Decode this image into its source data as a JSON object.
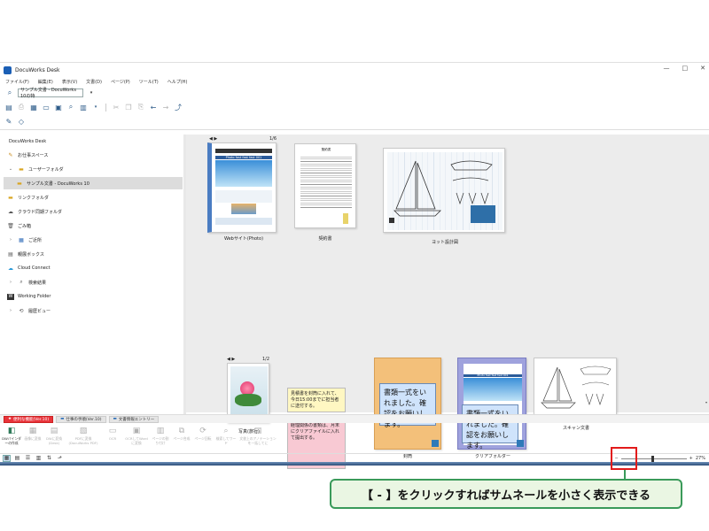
{
  "window": {
    "title": "DocuWorks Desk",
    "controls": [
      "—",
      "□",
      "✕"
    ]
  },
  "menu": [
    "ファイル(F)",
    "編集(E)",
    "表示(V)",
    "文書(D)",
    "ページ(P)",
    "ツール(T)",
    "ヘルプ(H)"
  ],
  "address": {
    "value": "サンプル文書 - DocuWorks 10の特"
  },
  "sidebar": {
    "root": "DocuWorks Desk",
    "items": [
      {
        "label": "お仕事スペース"
      },
      {
        "label": "ユーザーフォルダ"
      },
      {
        "label": "サンプル文書 - DocuWorks 10"
      },
      {
        "label": "リンクフォルダ"
      },
      {
        "label": "クラウド同期フォルダ"
      },
      {
        "label": "ごみ箱"
      },
      {
        "label": "ご近所"
      },
      {
        "label": "親展ボックス"
      },
      {
        "label": "Cloud Connect"
      },
      {
        "label": "検索結果"
      },
      {
        "label": "Working Folder"
      },
      {
        "label": "履歴ビュー"
      }
    ]
  },
  "documents": {
    "website": {
      "caption": "Webサイト(Photo)",
      "pager": "1/6",
      "banner": "Photo fast fast fast 001"
    },
    "contract": {
      "caption": "契約書",
      "title": "契約書"
    },
    "yacht": {
      "caption": "ヨット設計図"
    },
    "photo": {
      "caption": "写真(旅行)",
      "pager": "1/2"
    },
    "envelope": {
      "caption": "封筒",
      "text": "書類一式をいれました。確認をお願いします。"
    },
    "clearfolder": {
      "caption": "クリアフォルダー",
      "text": "書類一式をいれました。確認をお願いします。",
      "banner": "Photo fast fast fast 001"
    },
    "scan": {
      "caption": "スキャン文書"
    }
  },
  "stickies": {
    "yellow": "見積書を封筒に入れて、今日15:00までに担当者に送付する。",
    "pink": "経理関係の書類は、月末にクリアファイルに入れて提出する。"
  },
  "tabs": [
    {
      "label": "便利な機能(Ver.10)"
    },
    {
      "label": "仕事の手順(Ver.10)"
    },
    {
      "label": "文書情報エントリー"
    }
  ],
  "actions": [
    {
      "label": "DWバインダーの作成"
    },
    {
      "label": "画像に変換"
    },
    {
      "label": "DWに変換(Desk)"
    },
    {
      "label": "PDFに変換(DocuWorks PDF)"
    },
    {
      "label": "OCR"
    },
    {
      "label": "OCRしてWordに変換"
    },
    {
      "label": "ページの割り付け"
    },
    {
      "label": "ページ合成"
    },
    {
      "label": "ページ回転"
    },
    {
      "label": "検索してワード"
    },
    {
      "label": "文書上のアノテーションを一括してに"
    }
  ],
  "status": {
    "zoom": "27%",
    "minus": "−",
    "plus": "+"
  },
  "callout": {
    "text": "【 - 】をクリックすればサムネールを小さく表示できる"
  },
  "colors": {
    "highlight": "#e21b1b",
    "callout_border": "#3a9a5a",
    "active_tab": "#e8333a"
  }
}
